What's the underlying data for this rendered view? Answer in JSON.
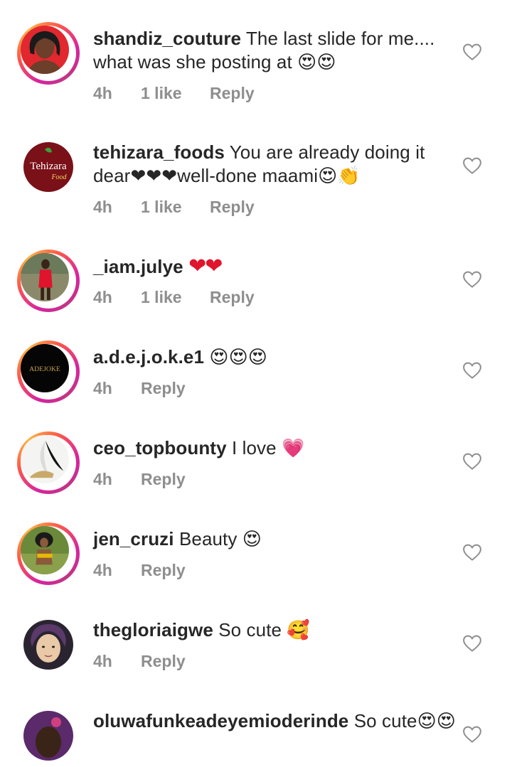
{
  "comments": [
    {
      "username": "shandiz_couture",
      "text": "The last slide for me.... what was she posting at 😍😍",
      "time": "4h",
      "likes": "1 like",
      "reply": "Reply"
    },
    {
      "username": "tehizara_foods",
      "text": "You are already doing it dear❤❤❤well-done maami😍👏",
      "time": "4h",
      "likes": "1 like",
      "reply": "Reply",
      "avatar_text": "Tehizara",
      "avatar_sub": "Food"
    },
    {
      "username": "_iam.julye",
      "text": "❤❤",
      "time": "4h",
      "likes": "1 like",
      "reply": "Reply"
    },
    {
      "username": "a.d.e.j.o.k.e1",
      "text": "😍😍😍",
      "time": "4h",
      "reply": "Reply",
      "avatar_text": "ADEJOKE"
    },
    {
      "username": "ceo_topbounty",
      "text": "I love 💗",
      "time": "4h",
      "reply": "Reply"
    },
    {
      "username": "jen_cruzi",
      "text": "Beauty 😍",
      "time": "4h",
      "reply": "Reply"
    },
    {
      "username": "thegloriaigwe",
      "text": "So cute 🥰",
      "time": "4h",
      "reply": "Reply"
    },
    {
      "username": "oluwafunkeadeyemioderinde",
      "text": "So cute😍😍",
      "time": "",
      "reply": ""
    }
  ],
  "icons": {
    "like": "heart-outline-icon"
  },
  "colors": {
    "heart_red": "#e0142c",
    "muted": "#8e8e8e",
    "text": "#262626"
  }
}
